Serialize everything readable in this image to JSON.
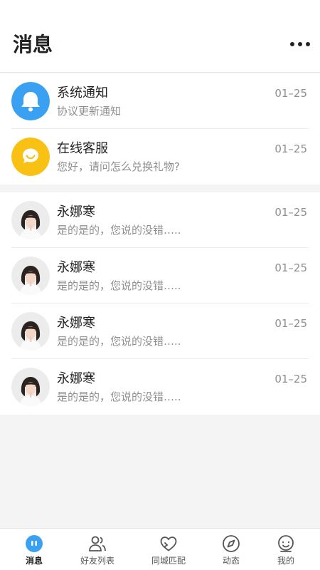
{
  "header": {
    "title": "消息",
    "more_icon": "more-icon"
  },
  "system_messages": [
    {
      "name": "系统通知",
      "preview": "协议更新通知",
      "time": "01–25",
      "icon": "bell-icon",
      "color": "#3aa0f2"
    },
    {
      "name": "在线客服",
      "preview": "您好，请问怎么兑换礼物?",
      "time": "01–25",
      "icon": "chat-bubble-icon",
      "color": "#f9c113"
    }
  ],
  "conversations": [
    {
      "name": "永娜寒",
      "preview": "是的是的，您说的没错…..",
      "time": "01–25"
    },
    {
      "name": "永娜寒",
      "preview": "是的是的，您说的没错…..",
      "time": "01–25"
    },
    {
      "name": "永娜寒",
      "preview": "是的是的，您说的没错…..",
      "time": "01–25"
    },
    {
      "name": "永娜寒",
      "preview": "是的是的，您说的没错…..",
      "time": "01–25"
    }
  ],
  "tabbar": [
    {
      "label": "消息",
      "icon": "message-icon",
      "active": true
    },
    {
      "label": "好友列表",
      "icon": "friends-icon",
      "active": false
    },
    {
      "label": "同城匹配",
      "icon": "heart-icon",
      "active": false
    },
    {
      "label": "动态",
      "icon": "compass-icon",
      "active": false
    },
    {
      "label": "我的",
      "icon": "profile-icon",
      "active": false
    }
  ],
  "colors": {
    "accent": "#3aa0f2",
    "service": "#f9c113",
    "background": "#f4f4f4"
  }
}
